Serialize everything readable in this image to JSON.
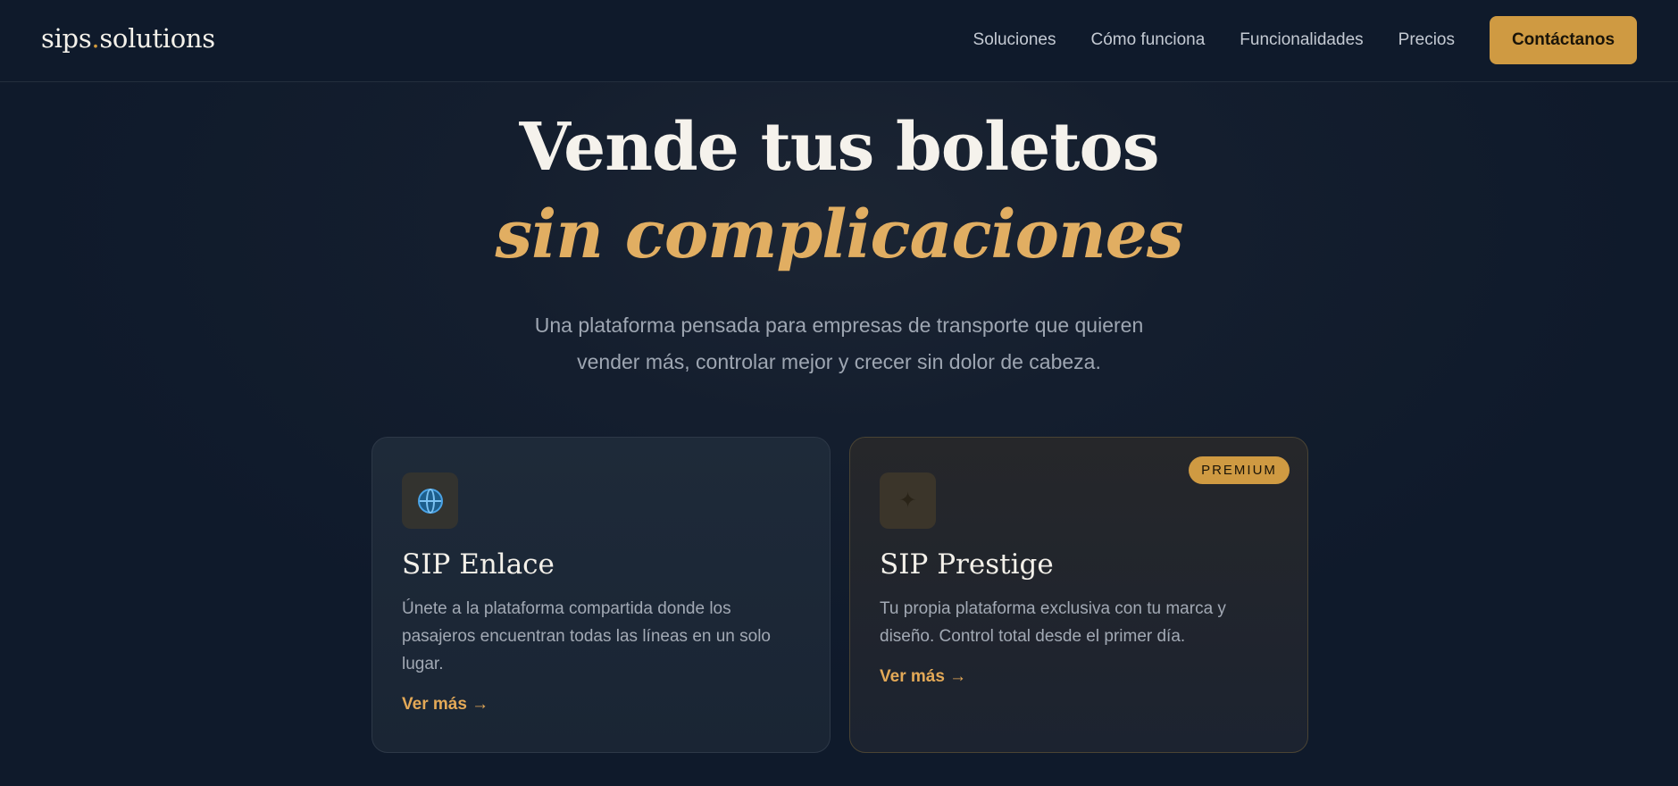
{
  "brand": {
    "name_part1": "sips",
    "dot": ".",
    "name_part2": "solutions"
  },
  "nav": {
    "links": [
      "Soluciones",
      "Cómo funciona",
      "Funcionalidades",
      "Precios"
    ],
    "cta": "Contáctanos"
  },
  "hero": {
    "title_line1": "Vende tus boletos",
    "title_line2": "sin complicaciones",
    "subtitle_line1": "Una plataforma pensada para empresas de transporte que quieren",
    "subtitle_line2": "vender más, controlar mejor y crecer sin dolor de cabeza."
  },
  "cards": [
    {
      "icon": "globe-icon",
      "title": "SIP Enlace",
      "description": "Únete a la plataforma compartida donde los pasajeros encuentran todas las líneas en un solo lugar.",
      "link": "Ver más →"
    },
    {
      "icon": "sparkle-icon",
      "badge": "PREMIUM",
      "title": "SIP Prestige",
      "description": "Tu propia plataforma exclusiva con tu marca y diseño. Control total desde el primer día.",
      "link": "Ver más →"
    }
  ],
  "colors": {
    "accent": "#cf9a42",
    "accent_text": "#e1ae62",
    "background": "#0f1a2b"
  }
}
